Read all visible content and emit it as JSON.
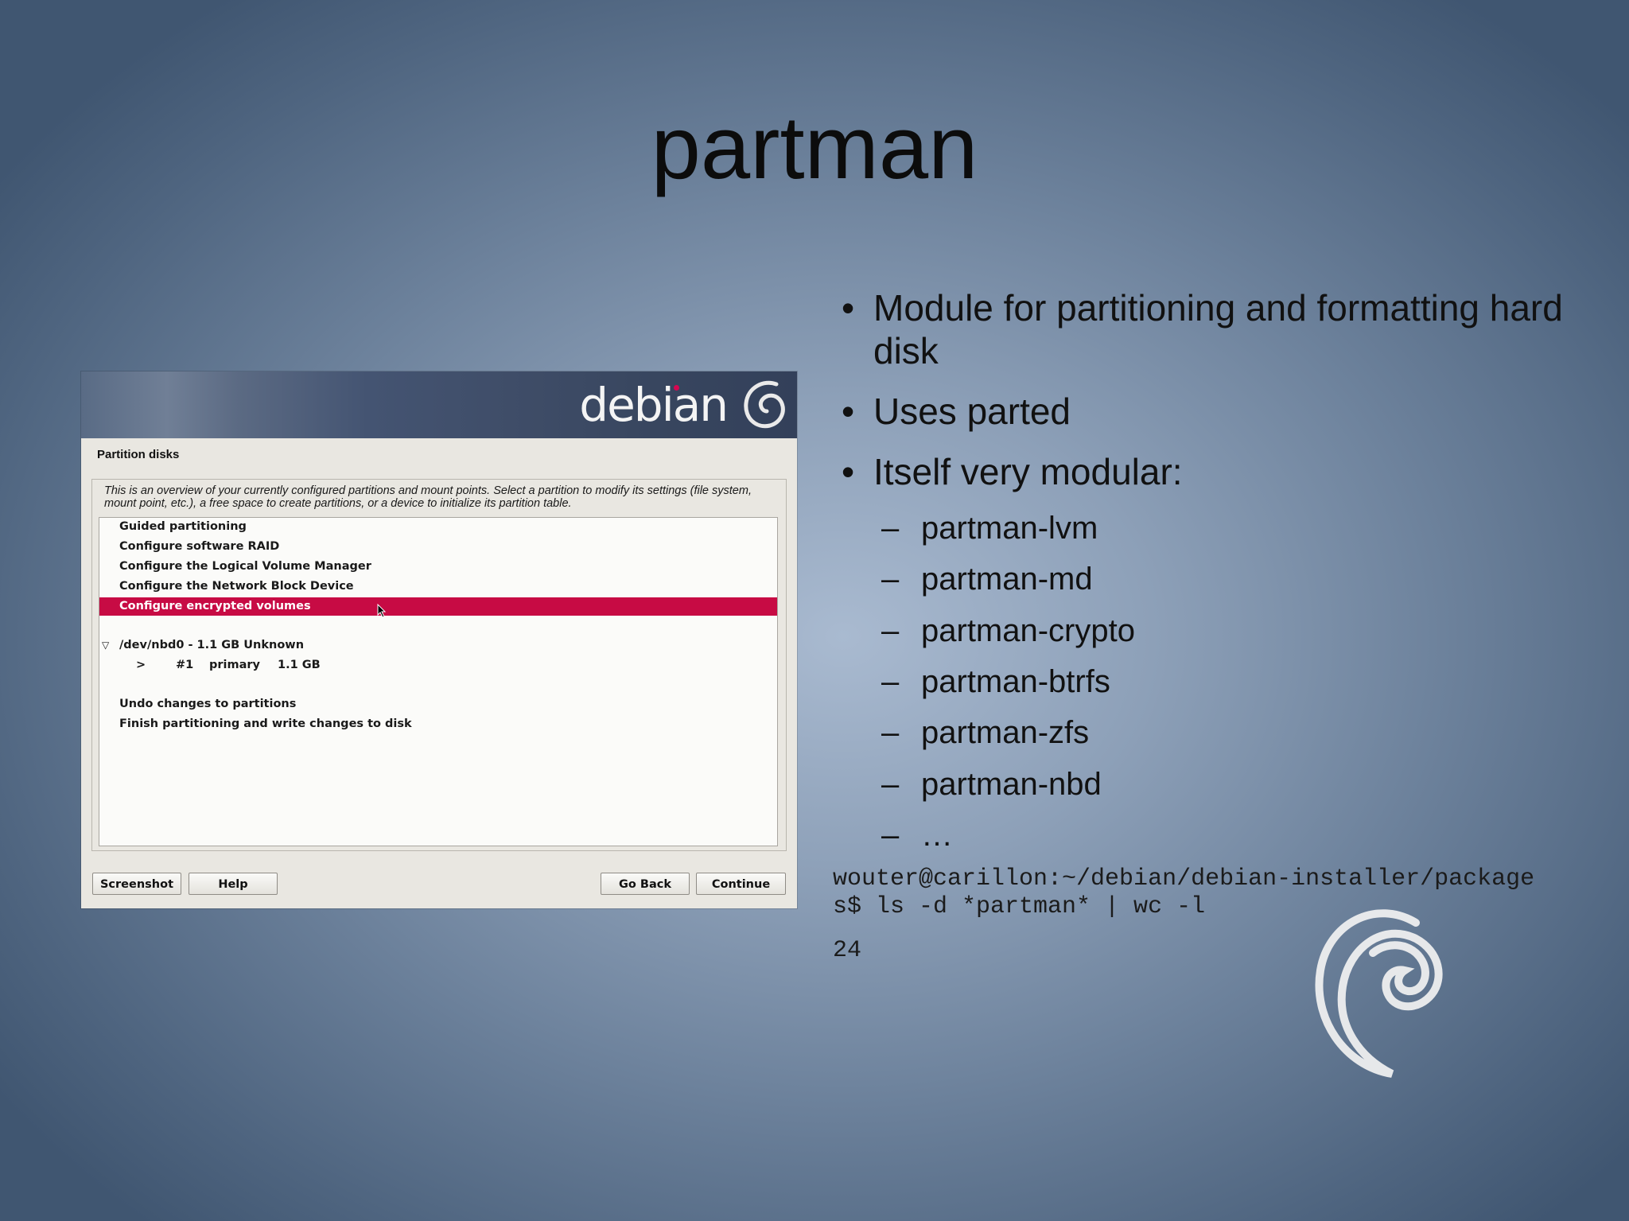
{
  "slide": {
    "title": "partman"
  },
  "installer": {
    "brand": "debian",
    "step_title": "Partition disks",
    "description": "This is an overview of your currently configured partitions and mount points. Select a partition to modify its settings (file system, mount point, etc.), a free space to create partitions, or a device to initialize its partition table.",
    "items": [
      {
        "label": "Guided partitioning"
      },
      {
        "label": "Configure software RAID"
      },
      {
        "label": "Configure the Logical Volume Manager"
      },
      {
        "label": "Configure the Network Block Device"
      },
      {
        "label": "Configure encrypted volumes",
        "selected": true
      }
    ],
    "device": {
      "label": "/dev/nbd0 - 1.1 GB Unknown",
      "expander": "▽",
      "partition": {
        "marker": ">",
        "number": "#1",
        "type": "primary",
        "size": "1.1 GB"
      }
    },
    "actions": [
      {
        "label": "Undo changes to partitions"
      },
      {
        "label": "Finish partitioning and write changes to disk"
      }
    ],
    "buttons": {
      "screenshot": "Screenshot",
      "help": "Help",
      "go_back": "Go Back",
      "continue": "Continue"
    },
    "selected_color": "#c70b44"
  },
  "bullets": [
    {
      "text": "Module for partitioning and formatting hard disk"
    },
    {
      "text": "Uses parted"
    },
    {
      "text": "Itself very modular:"
    }
  ],
  "sub_bullets": [
    {
      "text": "partman-lvm"
    },
    {
      "text": "partman-md"
    },
    {
      "text": "partman-crypto"
    },
    {
      "text": "partman-btrfs"
    },
    {
      "text": "partman-zfs"
    },
    {
      "text": "partman-nbd"
    },
    {
      "text": "…"
    }
  ],
  "bullet_glyph": "•",
  "dash_glyph": "–",
  "terminal": {
    "command": "wouter@carillon:~/debian/debian-installer/packages$ ls -d *partman* | wc -l",
    "output": "24"
  }
}
